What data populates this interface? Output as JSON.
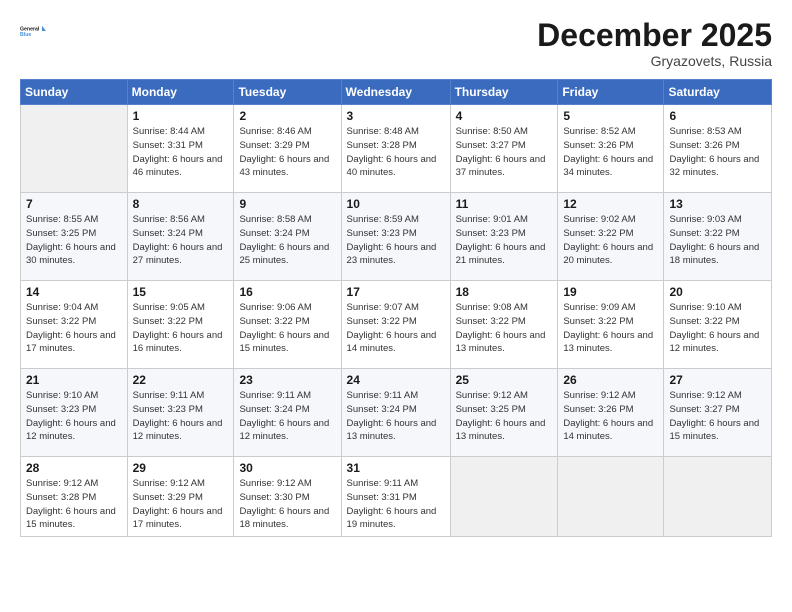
{
  "logo": {
    "line1": "General",
    "line2": "Blue"
  },
  "title": "December 2025",
  "subtitle": "Gryazovets, Russia",
  "days_of_week": [
    "Sunday",
    "Monday",
    "Tuesday",
    "Wednesday",
    "Thursday",
    "Friday",
    "Saturday"
  ],
  "weeks": [
    [
      {
        "day": "",
        "info": ""
      },
      {
        "day": "1",
        "info": "Sunrise: 8:44 AM\nSunset: 3:31 PM\nDaylight: 6 hours\nand 46 minutes."
      },
      {
        "day": "2",
        "info": "Sunrise: 8:46 AM\nSunset: 3:29 PM\nDaylight: 6 hours\nand 43 minutes."
      },
      {
        "day": "3",
        "info": "Sunrise: 8:48 AM\nSunset: 3:28 PM\nDaylight: 6 hours\nand 40 minutes."
      },
      {
        "day": "4",
        "info": "Sunrise: 8:50 AM\nSunset: 3:27 PM\nDaylight: 6 hours\nand 37 minutes."
      },
      {
        "day": "5",
        "info": "Sunrise: 8:52 AM\nSunset: 3:26 PM\nDaylight: 6 hours\nand 34 minutes."
      },
      {
        "day": "6",
        "info": "Sunrise: 8:53 AM\nSunset: 3:26 PM\nDaylight: 6 hours\nand 32 minutes."
      }
    ],
    [
      {
        "day": "7",
        "info": "Sunrise: 8:55 AM\nSunset: 3:25 PM\nDaylight: 6 hours\nand 30 minutes."
      },
      {
        "day": "8",
        "info": "Sunrise: 8:56 AM\nSunset: 3:24 PM\nDaylight: 6 hours\nand 27 minutes."
      },
      {
        "day": "9",
        "info": "Sunrise: 8:58 AM\nSunset: 3:24 PM\nDaylight: 6 hours\nand 25 minutes."
      },
      {
        "day": "10",
        "info": "Sunrise: 8:59 AM\nSunset: 3:23 PM\nDaylight: 6 hours\nand 23 minutes."
      },
      {
        "day": "11",
        "info": "Sunrise: 9:01 AM\nSunset: 3:23 PM\nDaylight: 6 hours\nand 21 minutes."
      },
      {
        "day": "12",
        "info": "Sunrise: 9:02 AM\nSunset: 3:22 PM\nDaylight: 6 hours\nand 20 minutes."
      },
      {
        "day": "13",
        "info": "Sunrise: 9:03 AM\nSunset: 3:22 PM\nDaylight: 6 hours\nand 18 minutes."
      }
    ],
    [
      {
        "day": "14",
        "info": "Sunrise: 9:04 AM\nSunset: 3:22 PM\nDaylight: 6 hours\nand 17 minutes."
      },
      {
        "day": "15",
        "info": "Sunrise: 9:05 AM\nSunset: 3:22 PM\nDaylight: 6 hours\nand 16 minutes."
      },
      {
        "day": "16",
        "info": "Sunrise: 9:06 AM\nSunset: 3:22 PM\nDaylight: 6 hours\nand 15 minutes."
      },
      {
        "day": "17",
        "info": "Sunrise: 9:07 AM\nSunset: 3:22 PM\nDaylight: 6 hours\nand 14 minutes."
      },
      {
        "day": "18",
        "info": "Sunrise: 9:08 AM\nSunset: 3:22 PM\nDaylight: 6 hours\nand 13 minutes."
      },
      {
        "day": "19",
        "info": "Sunrise: 9:09 AM\nSunset: 3:22 PM\nDaylight: 6 hours\nand 13 minutes."
      },
      {
        "day": "20",
        "info": "Sunrise: 9:10 AM\nSunset: 3:22 PM\nDaylight: 6 hours\nand 12 minutes."
      }
    ],
    [
      {
        "day": "21",
        "info": "Sunrise: 9:10 AM\nSunset: 3:23 PM\nDaylight: 6 hours\nand 12 minutes."
      },
      {
        "day": "22",
        "info": "Sunrise: 9:11 AM\nSunset: 3:23 PM\nDaylight: 6 hours\nand 12 minutes."
      },
      {
        "day": "23",
        "info": "Sunrise: 9:11 AM\nSunset: 3:24 PM\nDaylight: 6 hours\nand 12 minutes."
      },
      {
        "day": "24",
        "info": "Sunrise: 9:11 AM\nSunset: 3:24 PM\nDaylight: 6 hours\nand 13 minutes."
      },
      {
        "day": "25",
        "info": "Sunrise: 9:12 AM\nSunset: 3:25 PM\nDaylight: 6 hours\nand 13 minutes."
      },
      {
        "day": "26",
        "info": "Sunrise: 9:12 AM\nSunset: 3:26 PM\nDaylight: 6 hours\nand 14 minutes."
      },
      {
        "day": "27",
        "info": "Sunrise: 9:12 AM\nSunset: 3:27 PM\nDaylight: 6 hours\nand 15 minutes."
      }
    ],
    [
      {
        "day": "28",
        "info": "Sunrise: 9:12 AM\nSunset: 3:28 PM\nDaylight: 6 hours\nand 15 minutes."
      },
      {
        "day": "29",
        "info": "Sunrise: 9:12 AM\nSunset: 3:29 PM\nDaylight: 6 hours\nand 17 minutes."
      },
      {
        "day": "30",
        "info": "Sunrise: 9:12 AM\nSunset: 3:30 PM\nDaylight: 6 hours\nand 18 minutes."
      },
      {
        "day": "31",
        "info": "Sunrise: 9:11 AM\nSunset: 3:31 PM\nDaylight: 6 hours\nand 19 minutes."
      },
      {
        "day": "",
        "info": ""
      },
      {
        "day": "",
        "info": ""
      },
      {
        "day": "",
        "info": ""
      }
    ]
  ]
}
